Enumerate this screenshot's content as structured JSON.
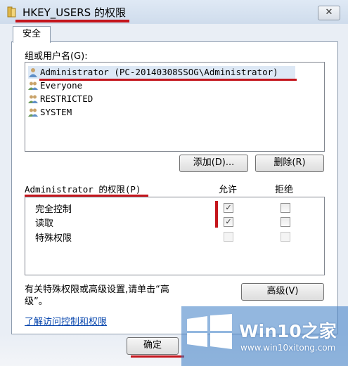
{
  "window": {
    "title": "HKEY_USERS 的权限",
    "close_label": "✕"
  },
  "tabs": [
    {
      "label": "安全"
    }
  ],
  "group_section": {
    "label": "组或用户名(G):",
    "users": [
      {
        "name": "Administrator (PC-20140308SSOG\\Administrator)",
        "selected": true
      },
      {
        "name": "Everyone",
        "selected": false
      },
      {
        "name": "RESTRICTED",
        "selected": false
      },
      {
        "name": "SYSTEM",
        "selected": false
      }
    ],
    "add_label": "添加(D)...",
    "remove_label": "删除(R)"
  },
  "permissions": {
    "header": "Administrator 的权限(P)",
    "allow_label": "允许",
    "deny_label": "拒绝",
    "items": [
      {
        "name": "完全控制",
        "allow": true,
        "deny": false,
        "enabled": true
      },
      {
        "name": "读取",
        "allow": true,
        "deny": false,
        "enabled": true
      },
      {
        "name": "特殊权限",
        "allow": false,
        "deny": false,
        "enabled": false
      }
    ]
  },
  "advanced": {
    "text_line1": "有关特殊权限或高级设置,请单击“高",
    "text_line2": "级”。",
    "button_label": "高级(V)"
  },
  "learn_link": "了解访问控制和权限",
  "footer": {
    "ok_label": "确定"
  },
  "watermark": {
    "brand": "Win10之家",
    "url": "www.win10xitong.com"
  },
  "colors": {
    "annotation_red": "#c4151c",
    "watermark_blue": "#3a7cc4"
  }
}
